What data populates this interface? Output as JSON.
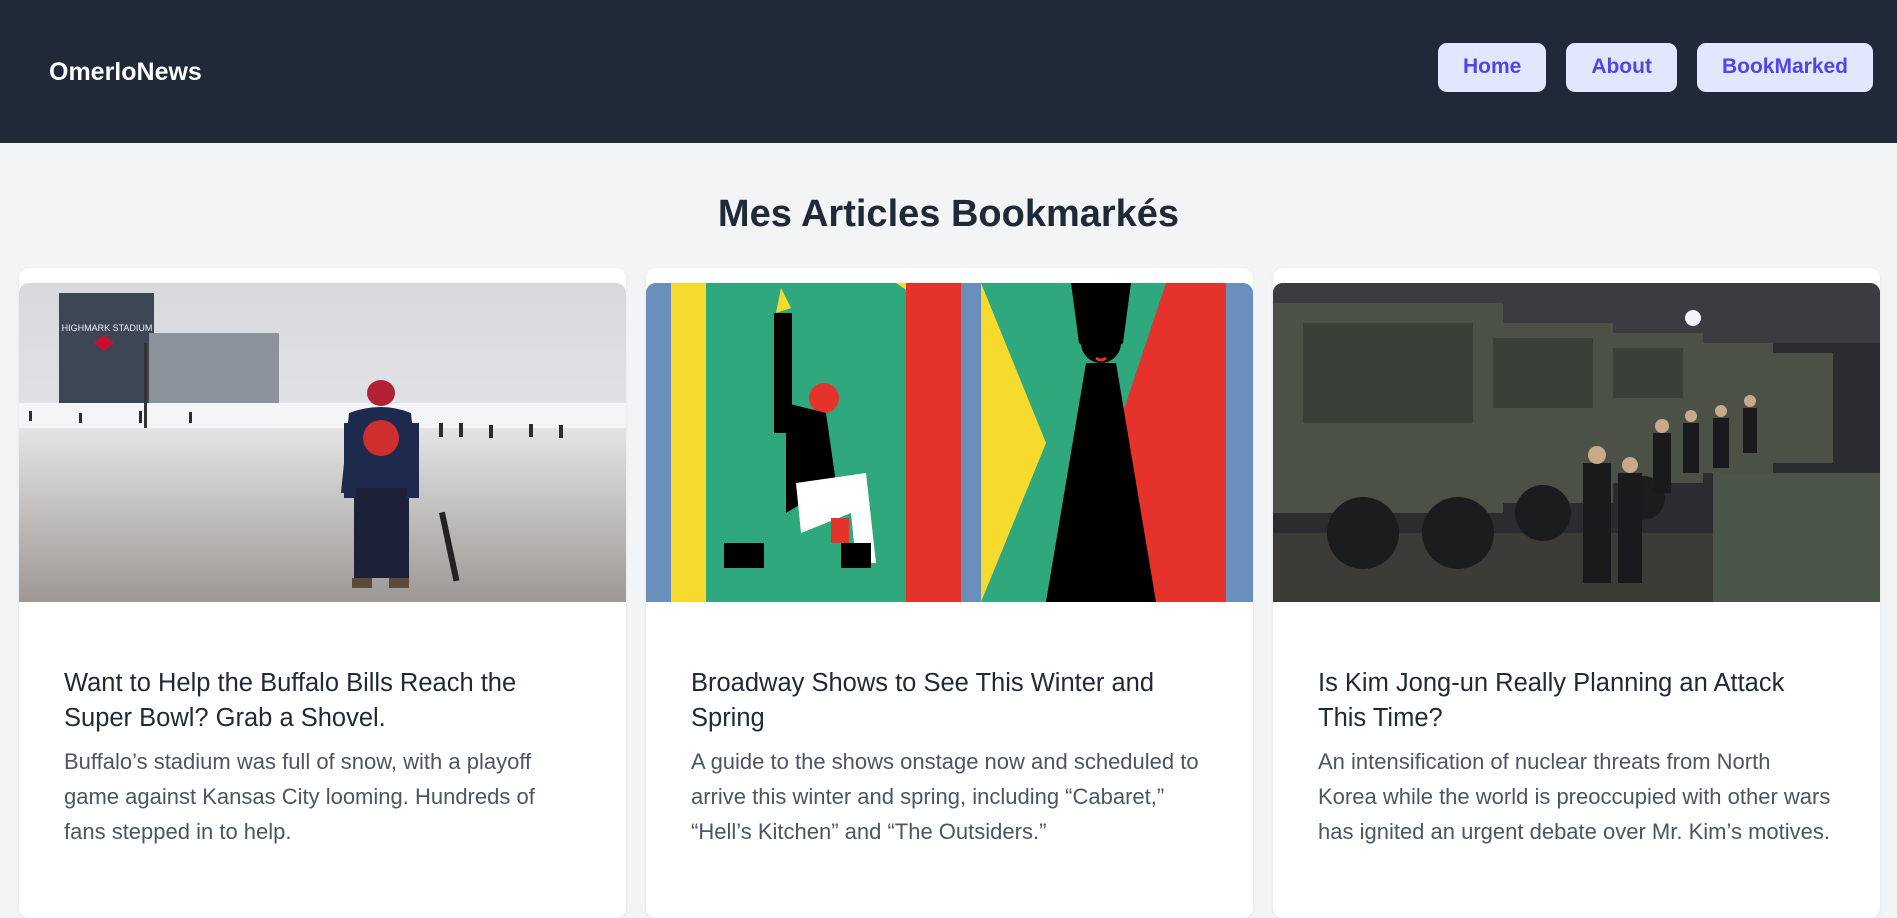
{
  "header": {
    "brand": "OmerloNews",
    "nav": [
      "Home",
      "About",
      "BookMarked"
    ]
  },
  "main": {
    "title": "Mes Articles Bookmarkés",
    "articles": [
      {
        "title": "Want to Help the Buffalo Bills Reach the Super Bowl? Grab a Shovel.",
        "description": "Buffalo’s stadium was full of snow, with a playoff game against Kansas City looming. Hundreds of fans stepped in to help.",
        "image_icon": "stadium-snow-photo",
        "sign_text": "HIGHMARK STADIUM"
      },
      {
        "title": "Broadway Shows to See This Winter and Spring",
        "description": "A guide to the shows onstage now and scheduled to arrive this winter and spring, including “Cabaret,” “Hell’s Kitchen” and “The Outsiders.”",
        "image_icon": "broadway-illustration"
      },
      {
        "title": "Is Kim Jong-un Really Planning an Attack This Time?",
        "description": "An intensification of nuclear threats from North Korea while the world is preoccupied with other wars has ignited an urgent debate over Mr. Kim’s motives.",
        "image_icon": "military-vehicles-photo"
      }
    ]
  },
  "colors": {
    "header_bg": "#1f2937",
    "nav_bg": "#e0e7ff",
    "nav_text": "#4f46e5",
    "page_bg": "#f3f4f6"
  }
}
